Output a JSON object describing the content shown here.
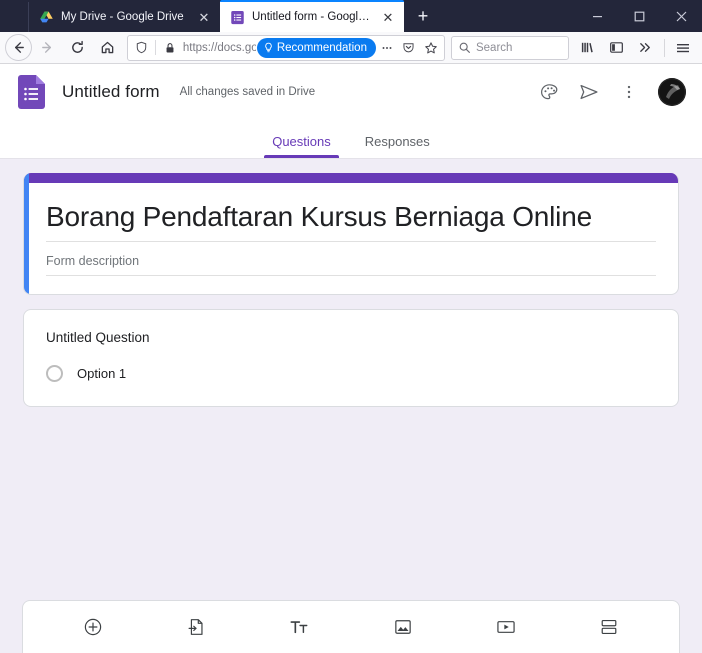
{
  "window": {
    "controls": {
      "minimize": "–",
      "maximize": "□",
      "close": "✕"
    },
    "newtab_label": "+"
  },
  "tabs": [
    {
      "title": "My Drive - Google Drive",
      "icon": "google-drive-icon",
      "active": false,
      "close": "✕"
    },
    {
      "title": "Untitled form - Google Forms",
      "icon": "google-forms-icon",
      "active": true,
      "close": "✕"
    }
  ],
  "navbar": {
    "back_icon": "back-arrow-icon",
    "forward_icon": "forward-arrow-icon",
    "reload_icon": "reload-icon",
    "home_icon": "home-icon",
    "url_text": "https://docs.go",
    "recommendation_label": "Recommendation",
    "recommendation_color": "#0a7bf0",
    "shield_icon": "tracking-protection-icon",
    "lock_icon": "padlock-icon",
    "page_actions_icon": "ellipsis-icon",
    "pocket_icon": "pocket-icon",
    "bookmark_icon": "star-icon",
    "search_placeholder": "Search",
    "library_icon": "library-icon",
    "sidebar_icon": "sidebar-icon",
    "overflow_icon": "double-chevron-icon",
    "menu_icon": "hamburger-menu-icon"
  },
  "forms_header": {
    "logo_icon": "google-forms-logo",
    "title": "Untitled form",
    "save_status": "All changes saved in Drive",
    "theme_icon": "palette-icon",
    "send_icon": "send-icon",
    "more_icon": "three-dot-menu-icon",
    "avatar_name": "user-avatar"
  },
  "form_tabs": [
    {
      "label": "Questions",
      "active": true
    },
    {
      "label": "Responses",
      "active": false
    }
  ],
  "theme": {
    "accent": "#673ab7",
    "selection": "#4285f4",
    "page_background": "#f0edf6"
  },
  "title_card": {
    "form_title": "Borang Pendaftaran Kursus Berniaga Online",
    "form_description_placeholder": "Form description"
  },
  "question_card": {
    "question_title": "Untitled Question",
    "options": [
      {
        "label": "Option 1",
        "selected": false
      }
    ]
  },
  "bottom_toolbar": {
    "buttons": [
      {
        "name": "add-question-button",
        "icon": "plus-circle-icon"
      },
      {
        "name": "import-questions-button",
        "icon": "import-document-icon"
      },
      {
        "name": "add-title-description-button",
        "icon": "text-tt-icon"
      },
      {
        "name": "add-image-button",
        "icon": "image-icon"
      },
      {
        "name": "add-video-button",
        "icon": "video-icon"
      },
      {
        "name": "add-section-button",
        "icon": "section-split-icon"
      }
    ]
  }
}
